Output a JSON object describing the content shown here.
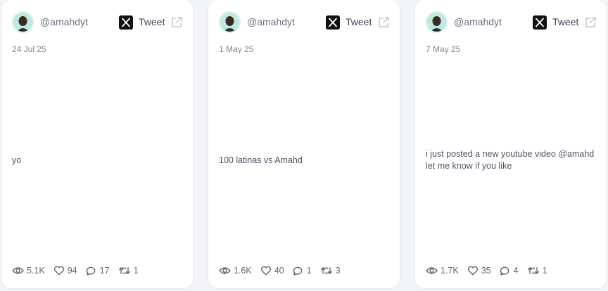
{
  "colors": {
    "background": "#f3f4f7",
    "card": "#ffffff",
    "text_muted": "#6b7280",
    "x_logo": "#111111"
  },
  "cards": [
    {
      "handle": "@amahdyt",
      "tweet_label": "Tweet",
      "date": "24 Jul 25",
      "text": "yo",
      "views": "5.1K",
      "likes": "94",
      "comments": "17",
      "retweets": "1"
    },
    {
      "handle": "@amahdyt",
      "tweet_label": "Tweet",
      "date": "1 May 25",
      "text": "100 latinas vs Amahd",
      "views": "1.6K",
      "likes": "40",
      "comments": "1",
      "retweets": "3"
    },
    {
      "handle": "@amahdyt",
      "tweet_label": "Tweet",
      "date": "7 May 25",
      "text": "i just posted a new youtube video @amahd let me know if you like",
      "views": "1.7K",
      "likes": "35",
      "comments": "4",
      "retweets": "1"
    }
  ]
}
